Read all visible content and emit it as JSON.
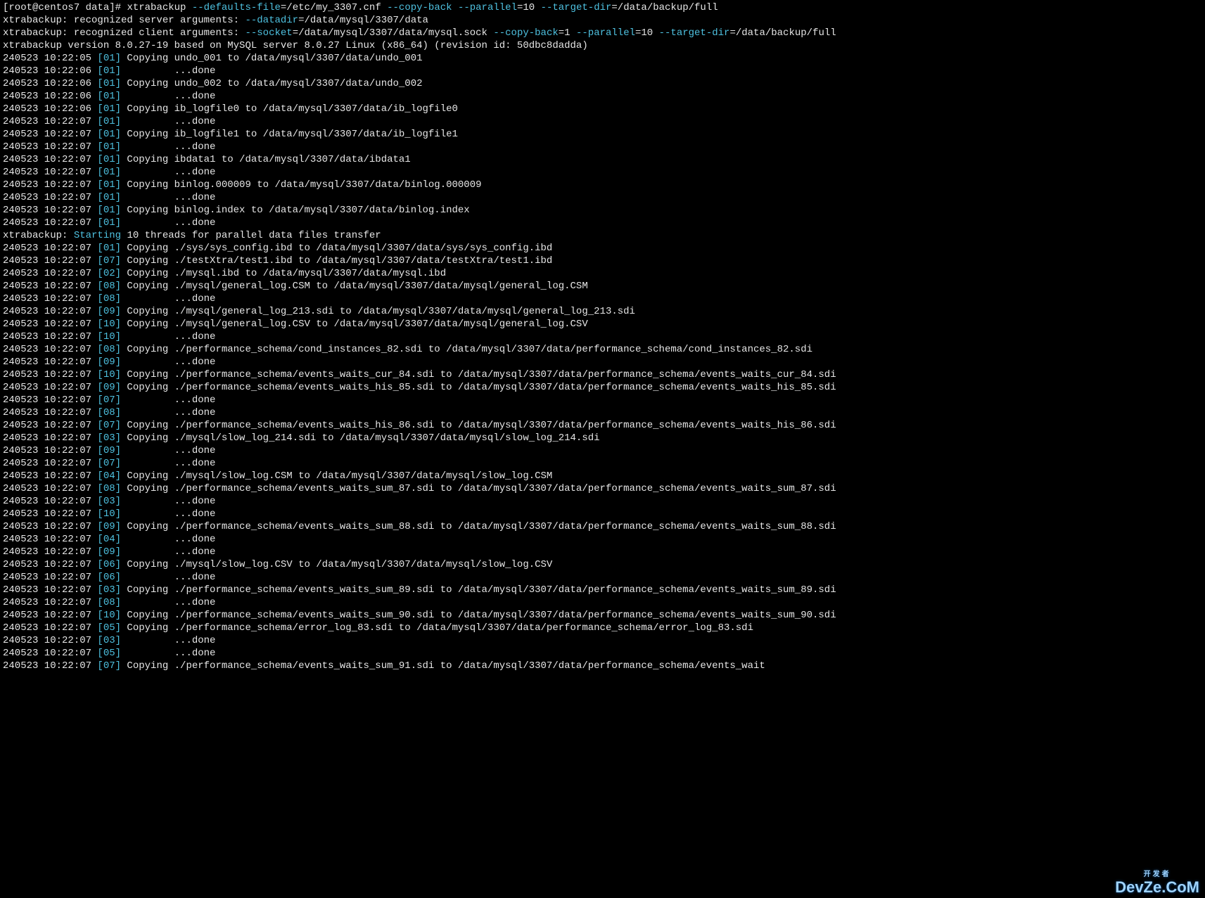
{
  "prompt": {
    "user": "root",
    "host": "centos7",
    "cwd": "data",
    "symbol": "#"
  },
  "command": {
    "bin": "xtrabackup",
    "args": [
      {
        "opt": "--defaults-file",
        "val": "=/etc/my_3307.cnf"
      },
      {
        "opt": "--copy-back",
        "val": ""
      },
      {
        "opt": "--parallel",
        "val": "=10"
      },
      {
        "opt": "--target-dir",
        "val": "=/data/backup/full"
      }
    ]
  },
  "header": [
    {
      "prefix": "xtrabackup: recognized server arguments: ",
      "opts": [
        {
          "opt": "--datadir",
          "val": "=/data/mysql/3307/data "
        }
      ]
    },
    {
      "prefix": "xtrabackup: recognized client arguments: ",
      "opts": [
        {
          "opt": "--socket",
          "val": "=/data/mysql/3307/data/mysql.sock "
        },
        {
          "opt": "--copy-back",
          "val": "=1 "
        },
        {
          "opt": "--parallel",
          "val": "=10 "
        },
        {
          "opt": "--target-dir",
          "val": "=/data/backup/full"
        }
      ]
    },
    {
      "prefix": "xtrabackup version 8.0.27-19 based on MySQL server 8.0.27 Linux (x86_64) (revision id: 50dbc8dadda)",
      "opts": []
    }
  ],
  "starting": {
    "prefix": "xtrabackup: ",
    "kw": "Starting",
    "rest": " 10 threads for parallel data files transfer"
  },
  "lines": [
    {
      "ts": "240523 10:22:05",
      "thr": "[01]",
      "msg": "Copying undo_001 to /data/mysql/3307/data/undo_001"
    },
    {
      "ts": "240523 10:22:06",
      "thr": "[01]",
      "msg": "        ...done"
    },
    {
      "ts": "240523 10:22:06",
      "thr": "[01]",
      "msg": "Copying undo_002 to /data/mysql/3307/data/undo_002"
    },
    {
      "ts": "240523 10:22:06",
      "thr": "[01]",
      "msg": "        ...done"
    },
    {
      "ts": "240523 10:22:06",
      "thr": "[01]",
      "msg": "Copying ib_logfile0 to /data/mysql/3307/data/ib_logfile0"
    },
    {
      "ts": "240523 10:22:07",
      "thr": "[01]",
      "msg": "        ...done"
    },
    {
      "ts": "240523 10:22:07",
      "thr": "[01]",
      "msg": "Copying ib_logfile1 to /data/mysql/3307/data/ib_logfile1"
    },
    {
      "ts": "240523 10:22:07",
      "thr": "[01]",
      "msg": "        ...done"
    },
    {
      "ts": "240523 10:22:07",
      "thr": "[01]",
      "msg": "Copying ibdata1 to /data/mysql/3307/data/ibdata1"
    },
    {
      "ts": "240523 10:22:07",
      "thr": "[01]",
      "msg": "        ...done"
    },
    {
      "ts": "240523 10:22:07",
      "thr": "[01]",
      "msg": "Copying binlog.000009 to /data/mysql/3307/data/binlog.000009"
    },
    {
      "ts": "240523 10:22:07",
      "thr": "[01]",
      "msg": "        ...done"
    },
    {
      "ts": "240523 10:22:07",
      "thr": "[01]",
      "msg": "Copying binlog.index to /data/mysql/3307/data/binlog.index"
    },
    {
      "ts": "240523 10:22:07",
      "thr": "[01]",
      "msg": "        ...done"
    }
  ],
  "lines2": [
    {
      "ts": "240523 10:22:07",
      "thr": "[01]",
      "msg": "Copying ./sys/sys_config.ibd to /data/mysql/3307/data/sys/sys_config.ibd"
    },
    {
      "ts": "240523 10:22:07",
      "thr": "[07]",
      "msg": "Copying ./testXtra/test1.ibd to /data/mysql/3307/data/testXtra/test1.ibd"
    },
    {
      "ts": "240523 10:22:07",
      "thr": "[02]",
      "msg": "Copying ./mysql.ibd to /data/mysql/3307/data/mysql.ibd"
    },
    {
      "ts": "240523 10:22:07",
      "thr": "[08]",
      "msg": "Copying ./mysql/general_log.CSM to /data/mysql/3307/data/mysql/general_log.CSM"
    },
    {
      "ts": "240523 10:22:07",
      "thr": "[08]",
      "msg": "        ...done"
    },
    {
      "ts": "240523 10:22:07",
      "thr": "[09]",
      "msg": "Copying ./mysql/general_log_213.sdi to /data/mysql/3307/data/mysql/general_log_213.sdi"
    },
    {
      "ts": "240523 10:22:07",
      "thr": "[10]",
      "msg": "Copying ./mysql/general_log.CSV to /data/mysql/3307/data/mysql/general_log.CSV"
    },
    {
      "ts": "240523 10:22:07",
      "thr": "[10]",
      "msg": "        ...done"
    },
    {
      "ts": "240523 10:22:07",
      "thr": "[08]",
      "msg": "Copying ./performance_schema/cond_instances_82.sdi to /data/mysql/3307/data/performance_schema/cond_instances_82.sdi"
    },
    {
      "ts": "240523 10:22:07",
      "thr": "[09]",
      "msg": "        ...done"
    },
    {
      "ts": "240523 10:22:07",
      "thr": "[10]",
      "msg": "Copying ./performance_schema/events_waits_cur_84.sdi to /data/mysql/3307/data/performance_schema/events_waits_cur_84.sdi"
    },
    {
      "ts": "240523 10:22:07",
      "thr": "[09]",
      "msg": "Copying ./performance_schema/events_waits_his_85.sdi to /data/mysql/3307/data/performance_schema/events_waits_his_85.sdi"
    },
    {
      "ts": "240523 10:22:07",
      "thr": "[07]",
      "msg": "        ...done"
    },
    {
      "ts": "240523 10:22:07",
      "thr": "[08]",
      "msg": "        ...done"
    },
    {
      "ts": "240523 10:22:07",
      "thr": "[07]",
      "msg": "Copying ./performance_schema/events_waits_his_86.sdi to /data/mysql/3307/data/performance_schema/events_waits_his_86.sdi"
    },
    {
      "ts": "240523 10:22:07",
      "thr": "[03]",
      "msg": "Copying ./mysql/slow_log_214.sdi to /data/mysql/3307/data/mysql/slow_log_214.sdi"
    },
    {
      "ts": "240523 10:22:07",
      "thr": "[09]",
      "msg": "        ...done"
    },
    {
      "ts": "240523 10:22:07",
      "thr": "[07]",
      "msg": "        ...done"
    },
    {
      "ts": "240523 10:22:07",
      "thr": "[04]",
      "msg": "Copying ./mysql/slow_log.CSM to /data/mysql/3307/data/mysql/slow_log.CSM"
    },
    {
      "ts": "240523 10:22:07",
      "thr": "[08]",
      "msg": "Copying ./performance_schema/events_waits_sum_87.sdi to /data/mysql/3307/data/performance_schema/events_waits_sum_87.sdi"
    },
    {
      "ts": "240523 10:22:07",
      "thr": "[03]",
      "msg": "        ...done"
    },
    {
      "ts": "240523 10:22:07",
      "thr": "[10]",
      "msg": "        ...done"
    },
    {
      "ts": "240523 10:22:07",
      "thr": "[09]",
      "msg": "Copying ./performance_schema/events_waits_sum_88.sdi to /data/mysql/3307/data/performance_schema/events_waits_sum_88.sdi"
    },
    {
      "ts": "240523 10:22:07",
      "thr": "[04]",
      "msg": "        ...done"
    },
    {
      "ts": "240523 10:22:07",
      "thr": "[09]",
      "msg": "        ...done"
    },
    {
      "ts": "240523 10:22:07",
      "thr": "[06]",
      "msg": "Copying ./mysql/slow_log.CSV to /data/mysql/3307/data/mysql/slow_log.CSV"
    },
    {
      "ts": "240523 10:22:07",
      "thr": "[06]",
      "msg": "        ...done"
    },
    {
      "ts": "240523 10:22:07",
      "thr": "[03]",
      "msg": "Copying ./performance_schema/events_waits_sum_89.sdi to /data/mysql/3307/data/performance_schema/events_waits_sum_89.sdi"
    },
    {
      "ts": "240523 10:22:07",
      "thr": "[08]",
      "msg": "        ...done"
    },
    {
      "ts": "240523 10:22:07",
      "thr": "[10]",
      "msg": "Copying ./performance_schema/events_waits_sum_90.sdi to /data/mysql/3307/data/performance_schema/events_waits_sum_90.sdi"
    },
    {
      "ts": "240523 10:22:07",
      "thr": "[05]",
      "msg": "Copying ./performance_schema/error_log_83.sdi to /data/mysql/3307/data/performance_schema/error_log_83.sdi"
    },
    {
      "ts": "240523 10:22:07",
      "thr": "[03]",
      "msg": "        ...done"
    },
    {
      "ts": "240523 10:22:07",
      "thr": "[05]",
      "msg": "        ...done"
    },
    {
      "ts": "240523 10:22:07",
      "thr": "[07]",
      "msg": "Copying ./performance_schema/events_waits_sum_91.sdi to /data/mysql/3307/data/performance_schema/events_wait"
    }
  ],
  "watermark": {
    "main": "DevZe.CoM",
    "sub": "开发者"
  }
}
